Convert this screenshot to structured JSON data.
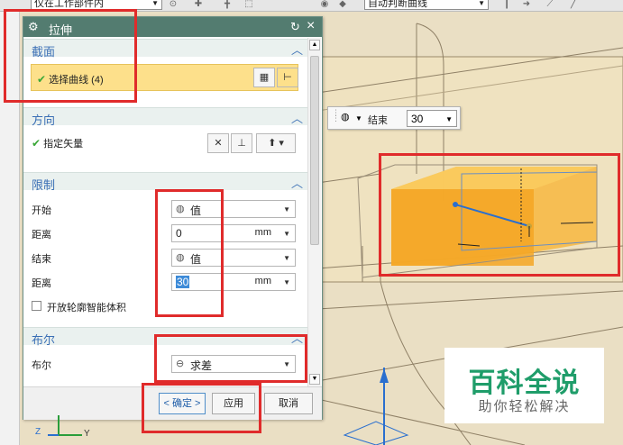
{
  "toolbar": {
    "filter_combo": "仅在工作部件内",
    "curve_rule_combo": "自动判断曲线"
  },
  "dialog": {
    "title": "拉伸",
    "section": {
      "label": "截面",
      "select_curve": "选择曲线 (4)"
    },
    "direction": {
      "label": "方向",
      "specify_vector": "指定矢量"
    },
    "limits": {
      "label": "限制",
      "start_label": "开始",
      "start_value": "值",
      "distance1_label": "距离",
      "distance1_value": "0",
      "distance1_unit": "mm",
      "end_label": "结束",
      "end_value": "值",
      "distance2_label": "距离",
      "distance2_value": "30",
      "distance2_unit": "mm",
      "open_profile_label": "开放轮廓智能体积"
    },
    "boolean": {
      "label": "布尔",
      "field_label": "布尔",
      "value": "求差"
    },
    "buttons": {
      "ok": "< 确定 >",
      "apply": "应用",
      "cancel": "取消"
    }
  },
  "mini_toolbar": {
    "end_label": "结束",
    "end_value": "30"
  },
  "watermark": {
    "title": "百科全说",
    "subtitle": "助你轻松解决"
  },
  "triad": {
    "z": "Z",
    "y": "Y"
  },
  "colors": {
    "accent": "#537c70",
    "section_label": "#3a6fb5",
    "selection_row": "#fde08b",
    "extrude_body": "#f5a623",
    "highlight_red": "#e02b2b"
  }
}
